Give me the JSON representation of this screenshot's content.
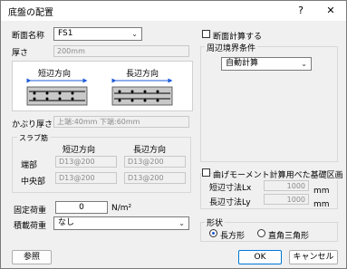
{
  "window": {
    "title": "底盤の配置",
    "help": "?",
    "close": "✕"
  },
  "section": {
    "label": "断面名称",
    "value": "FS1"
  },
  "thickness": {
    "label": "厚さ",
    "value": "200mm"
  },
  "diagram": {
    "short_label": "短辺方向",
    "long_label": "長辺方向"
  },
  "cover": {
    "label": "かぶり厚さ",
    "value": "上端:40mm 下端:60mm"
  },
  "rebar": {
    "group_label": "スラブ筋",
    "col_short": "短辺方向",
    "col_long": "長辺方向",
    "end_label": "端部",
    "center_label": "中央部",
    "end_short": "D13@200",
    "end_long": "D13@200",
    "center_short": "D13@200",
    "center_long": "D13@200"
  },
  "fixed_load": {
    "label": "固定荷重",
    "value": "0",
    "unit": "N/m²"
  },
  "live_load": {
    "label": "積載荷重",
    "value": "なし"
  },
  "reference_button": "参照",
  "section_calc": {
    "label": "断面計算する",
    "checked": false
  },
  "boundary": {
    "group_label": "周辺境界条件",
    "value": "自動計算"
  },
  "base_area": {
    "label": "曲げモーメント計算用べた基礎区画",
    "checked": false,
    "short_label": "短辺寸法Lx",
    "short_value": "1000",
    "short_unit": "mm",
    "long_label": "長辺寸法Ly",
    "long_value": "1000",
    "long_unit": "mm"
  },
  "shape": {
    "group_label": "形状",
    "rect_label": "長方形",
    "tri_label": "直角三角形",
    "selected": "長方形"
  },
  "ok_button": "OK",
  "cancel_button": "キャンセル"
}
